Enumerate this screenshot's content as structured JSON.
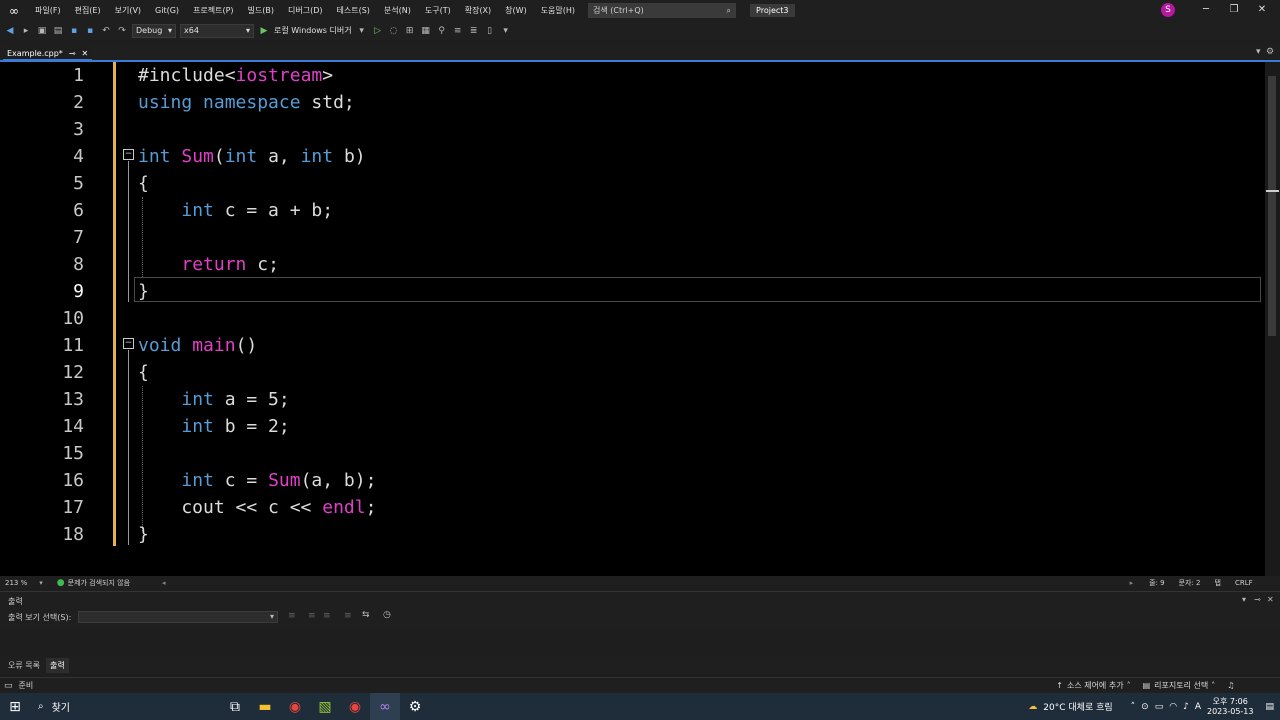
{
  "menubar": {
    "items": [
      "파일(F)",
      "편집(E)",
      "보기(V)",
      "Git(G)",
      "프로젝트(P)",
      "빌드(B)",
      "디버그(D)",
      "테스트(S)",
      "분석(N)",
      "도구(T)",
      "확장(X)",
      "창(W)",
      "도움말(H)"
    ],
    "search_placeholder": "검색 (Ctrl+Q)",
    "project_name": "Project3",
    "account_initial": "S"
  },
  "toolbar": {
    "configuration": "Debug",
    "platform": "x64",
    "debugger_label": "로컬 Windows 디버거"
  },
  "tabs": {
    "active_file": "Example.cpp*"
  },
  "editor": {
    "current_line": 9,
    "lines": [
      "1",
      "2",
      "3",
      "4",
      "5",
      "6",
      "7",
      "8",
      "9",
      "10",
      "11",
      "12",
      "13",
      "14",
      "15",
      "16",
      "17",
      "18"
    ]
  },
  "editor_status": {
    "zoom": "213 %",
    "issues": "문제가 검색되지 않음",
    "line": "줄: 9",
    "char": "문자: 2",
    "whitespace": "탭",
    "line_ending": "CRLF"
  },
  "output": {
    "title": "출력",
    "show_from_label": "출력 보기 선택(S):"
  },
  "bottom_tabs": [
    "오류 목록",
    "출력"
  ],
  "status_bar": {
    "ready": "준비",
    "source_control": "소스 제어에 추가",
    "repo_select": "리포지토리 선택"
  },
  "taskbar": {
    "search_label": "찾기",
    "weather": "20°C  대체로 흐림",
    "time": "오후 7:06",
    "date": "2023-05-13",
    "ime": "A"
  }
}
